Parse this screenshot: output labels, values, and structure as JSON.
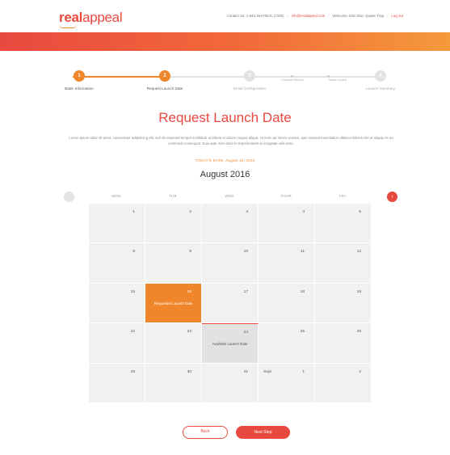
{
  "header": {
    "logo_bold": "real",
    "logo_thin": "appeal",
    "contact_text": "Contact Us: 1-844-344-REAL (7325)",
    "email": "info@realappeal.com",
    "welcome_text": "Welcome John Doe, Quake Trap",
    "logout": "Log out",
    "brand_color": "#e8493f",
    "accent_color": "#f0862c"
  },
  "stepper": {
    "steps": [
      {
        "number": "1",
        "label": "Basic Information",
        "state": "complete"
      },
      {
        "number": "2",
        "label": "Request Launch Date",
        "state": "current"
      },
      {
        "number": "3",
        "label": "Email Configuration",
        "state": "upcoming"
      },
      {
        "number": "4",
        "label": "Launch Summary",
        "state": "upcoming"
      }
    ],
    "substeps": [
      "Contract Review",
      "Sales Invoice"
    ]
  },
  "main": {
    "title": "Request Launch Date",
    "intro": "Lorem ipsum dolor sit amet, consectetur adipisicing elit, sed do eiusmod tempor incididunt ut labore et dolore magna aliqua. Ut enim ad minim veniam, quis nostrud exercitation ullamco laboris nisi ut aliquip ex ea commodo consequat. Duis aute irure dolor in reprehenderit in voluptate velit esse.",
    "today": "TODAY'S DATE: August 10, 2016",
    "month": "August 2016"
  },
  "calendar": {
    "days": [
      "MON",
      "TUE",
      "WED",
      "THUR",
      "FRI"
    ],
    "weeks": [
      [
        {
          "num": "1"
        },
        {
          "num": "2"
        },
        {
          "num": "3"
        },
        {
          "num": "4"
        },
        {
          "num": "5"
        }
      ],
      [
        {
          "num": "8"
        },
        {
          "num": "9"
        },
        {
          "num": "10"
        },
        {
          "num": "11"
        },
        {
          "num": "12"
        }
      ],
      [
        {
          "num": "15"
        },
        {
          "num": "16",
          "state": "requested",
          "caption": "Requested Launch Date"
        },
        {
          "num": "17"
        },
        {
          "num": "18"
        },
        {
          "num": "19"
        }
      ],
      [
        {
          "num": "22"
        },
        {
          "num": "23"
        },
        {
          "num": "24",
          "state": "available",
          "caption": "Available Launch Date"
        },
        {
          "num": "25"
        },
        {
          "num": "26"
        }
      ],
      [
        {
          "num": "29"
        },
        {
          "num": "30"
        },
        {
          "num": "31"
        },
        {
          "num": "1",
          "extra": "Sept"
        },
        {
          "num": "2"
        }
      ]
    ]
  },
  "footer": {
    "back_label": "Back",
    "next_label": "Next Step"
  }
}
